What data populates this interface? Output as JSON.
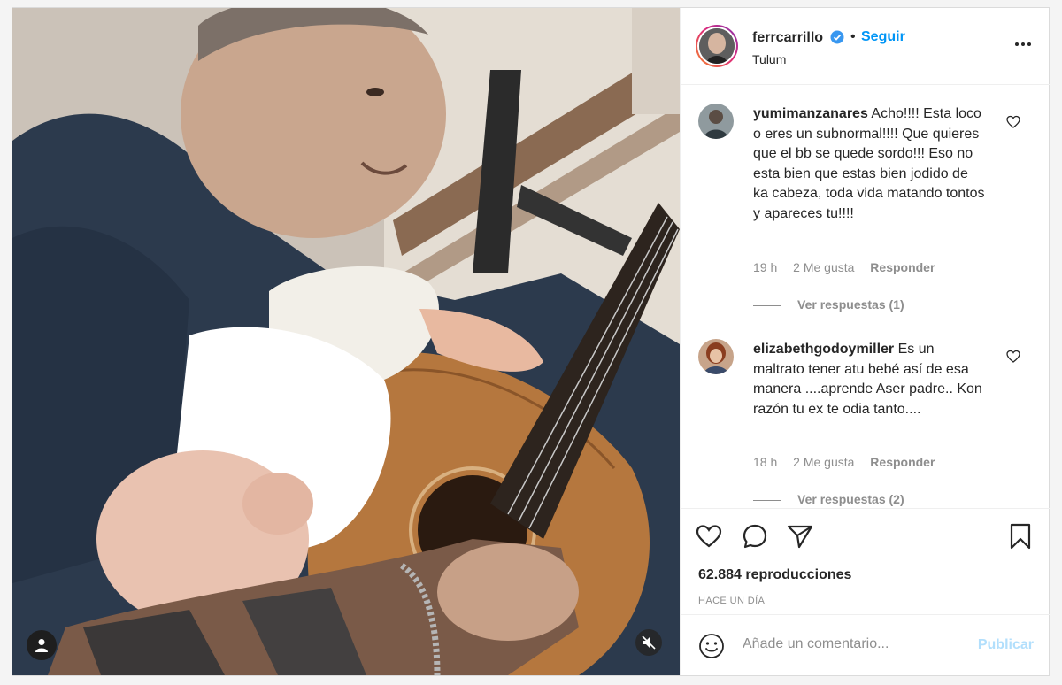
{
  "post": {
    "username": "ferrcarrillo",
    "verified_icon": "verified-badge-icon",
    "dot": "•",
    "follow_label": "Seguir",
    "location": "Tulum"
  },
  "comments": [
    {
      "username": "yumimanzanares",
      "text": "Acho!!!! Esta loco o eres un subnormal!!!! Que quieres que el bb se quede sordo!!! Eso no esta bien que estas bien jodido de ka cabeza, toda vida matando tontos y apareces tu!!!!",
      "time": "19 h",
      "likes": "2 Me gusta",
      "reply_label": "Responder",
      "replies_label": "Ver respuestas (1)"
    },
    {
      "username": "elizabethgodoymiller",
      "text": "Es un maltrato tener atu bebé así de esa manera ....aprende Aser padre.. Kon razón tu ex te odia tanto....",
      "time": "18 h",
      "likes": "2 Me gusta",
      "reply_label": "Responder",
      "replies_label": "Ver respuestas (2)"
    }
  ],
  "actions": {
    "views": "62.884 reproducciones",
    "date": "HACE UN DÍA"
  },
  "add_comment": {
    "placeholder": "Añade un comentario...",
    "publish_label": "Publicar"
  },
  "colors": {
    "accent": "#0095f6",
    "publish_disabled": "#b2dffc",
    "secondary_text": "#8e8e8e",
    "border": "#dbdbdb"
  }
}
